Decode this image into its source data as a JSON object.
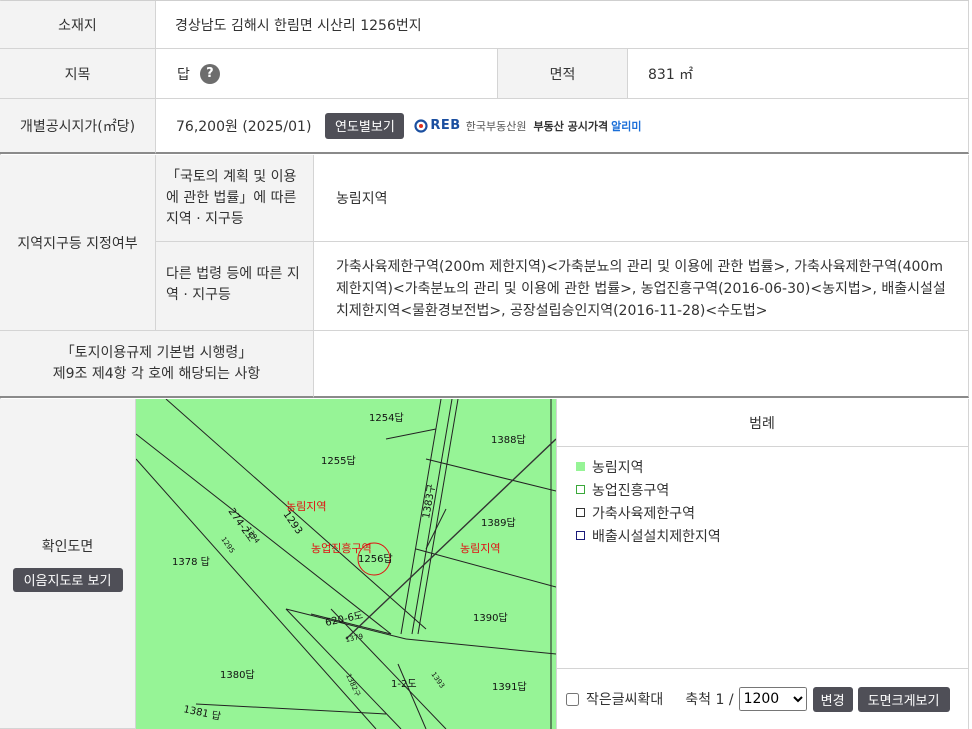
{
  "location": {
    "label": "소재지",
    "value": "경상남도 김해시 한림면 시산리 1256번지"
  },
  "land_type": {
    "label": "지목",
    "value": "답",
    "help": "?"
  },
  "area": {
    "label": "면적",
    "value": "831 ㎡"
  },
  "price": {
    "label": "개별공시지가(㎡당)",
    "value": "76,200원 (2025/01)",
    "button": "연도별보기",
    "reb_logo": "REB",
    "reb_org": "한국부동산원",
    "reb_service": "부동산 공시가격",
    "reb_link": "알리미"
  },
  "zoning": {
    "label": "지역지구등 지정여부",
    "national_label": "「국토의 계획 및 이용에 관한 법률」에 따른 지역 · 지구등",
    "national_value": "농림지역",
    "other_label": "다른 법령 등에 따른 지역 · 지구등",
    "other_value": "가축사육제한구역(200m 제한지역)<가축분뇨의 관리 및 이용에 관한 법률>, 가축사육제한구역(400m 제한지역)<가축분뇨의 관리 및 이용에 관한 법률>, 농업진흥구역(2016-06-30)<농지법>, 배출시설설치제한지역<물환경보전법>, 공장설립승인지역(2016-11-28)<수도법>"
  },
  "land_use_act": {
    "label_line1": "「토지이용규제 기본법 시행령」",
    "label_line2": "제9조 제4항 각 호에 해당되는 사항",
    "value": ""
  },
  "map_section": {
    "label": "확인도면",
    "button": "이음지도로 보기"
  },
  "map": {
    "parcels": [
      "1254답",
      "1388답",
      "1255답",
      "274-2도",
      "1293",
      "1383구",
      "1389답",
      "1378 답",
      "1256답",
      "1390답",
      "620-6도",
      "1380답",
      "1-2도",
      "1391답",
      "1381 답",
      "1382구",
      "1295",
      "1379",
      "1393",
      "1394"
    ],
    "zone_labels": [
      "농림지역",
      "농업진흥구역",
      "농림지역"
    ],
    "colors": {
      "zone_fill": "#96f496",
      "zone_text": "#e01010"
    }
  },
  "legend": {
    "title": "범례",
    "items": [
      {
        "label": "농림지역",
        "fill": "#96f496",
        "border": "#96f496"
      },
      {
        "label": "농업진흥구역",
        "fill": "#ffffff",
        "border": "#3aa83a"
      },
      {
        "label": "가축사육제한구역",
        "fill": "#ffffff",
        "border": "#333333"
      },
      {
        "label": "배출시설설치제한지역",
        "fill": "#ffffff",
        "border": "#1a1a7a"
      }
    ]
  },
  "controls": {
    "small_text_label": "작은글씨확대",
    "scale_label": "축척 1 /",
    "scale_value": "1200",
    "scale_options": [
      "1200"
    ],
    "change_button": "변경",
    "enlarge_button": "도면크게보기"
  }
}
